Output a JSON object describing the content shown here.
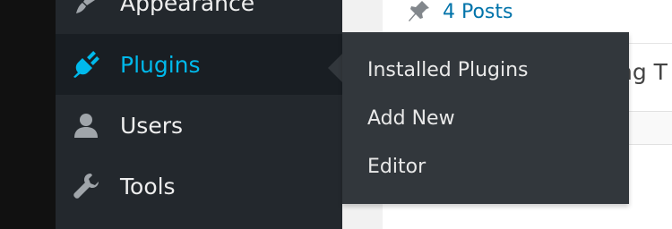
{
  "sidebar": {
    "items": [
      {
        "label": "Appearance",
        "icon": "paintbrush-icon"
      },
      {
        "label": "Plugins",
        "icon": "plugin-icon",
        "active": true
      },
      {
        "label": "Users",
        "icon": "user-icon"
      },
      {
        "label": "Tools",
        "icon": "wrench-icon"
      }
    ]
  },
  "submenu": {
    "items": [
      "Installed Plugins",
      "Add New",
      "Editor"
    ]
  },
  "content": {
    "posts_link": "4 Posts",
    "partial_text": "ng T"
  },
  "colors": {
    "sidebar_bg": "#23282d",
    "active_bg": "#191e23",
    "accent": "#00b9eb",
    "flyout_bg": "#32373c",
    "link": "#0073aa"
  }
}
